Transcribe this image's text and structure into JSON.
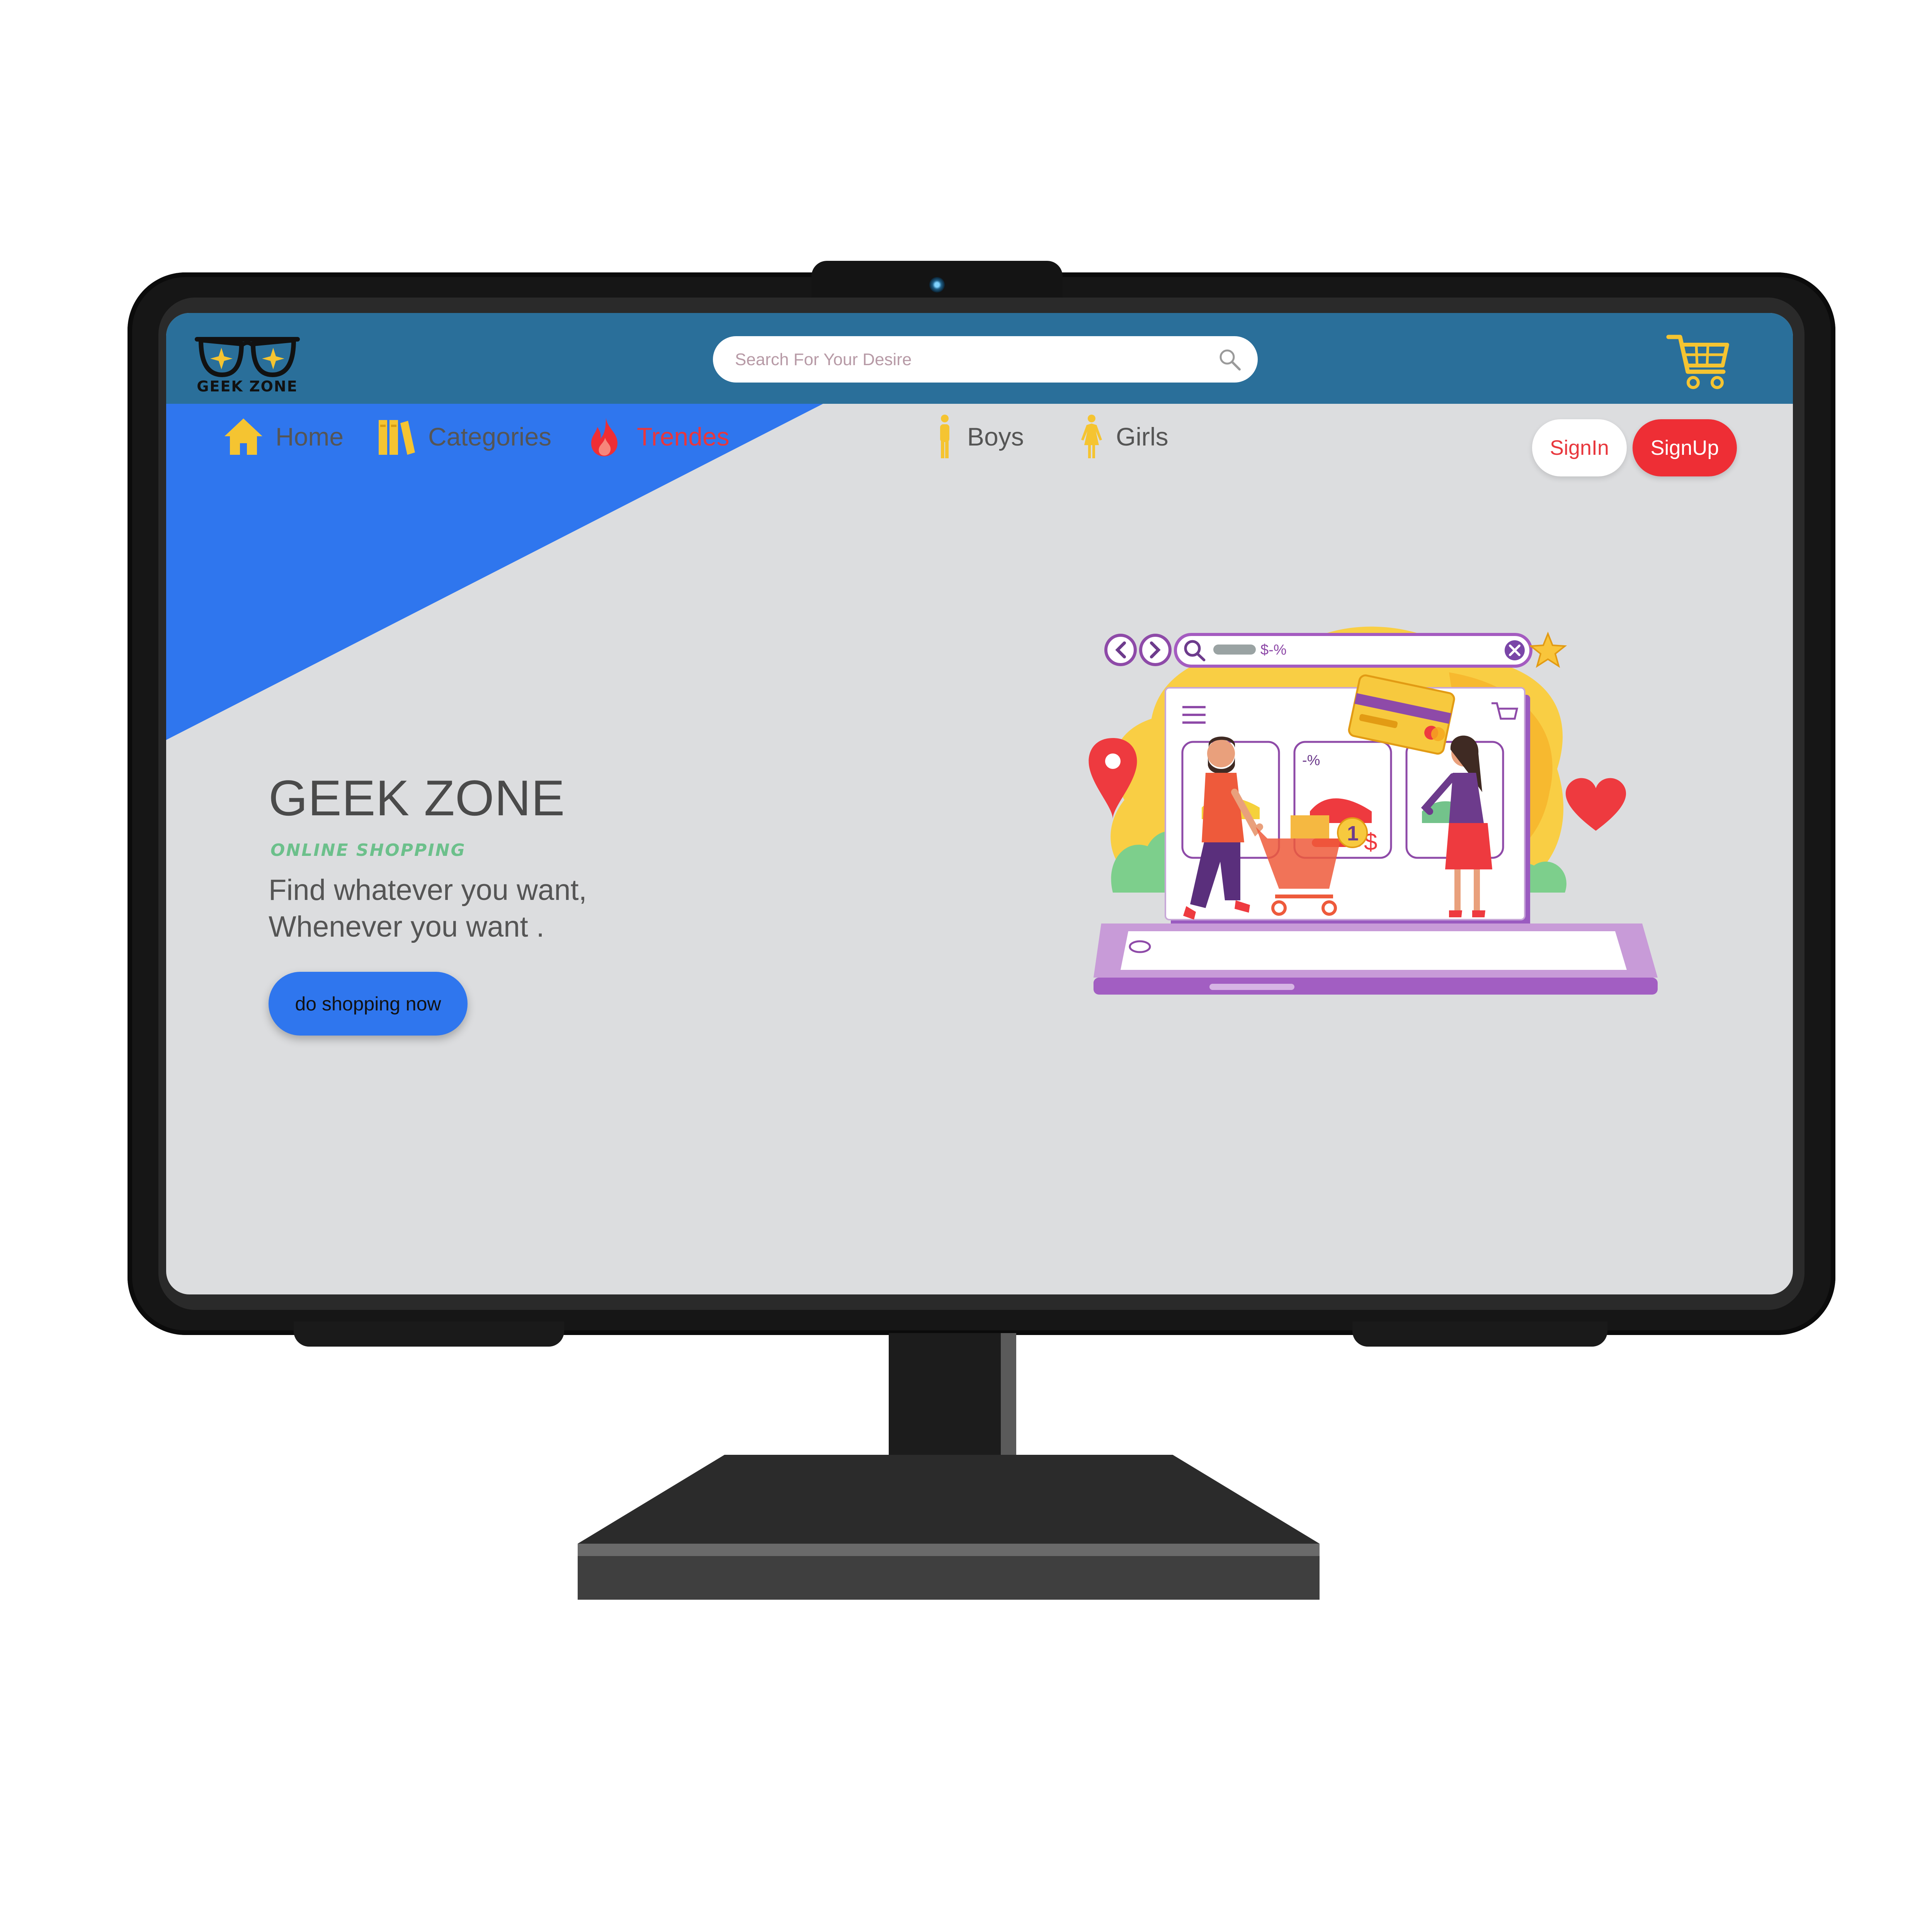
{
  "brand": {
    "logo_text": "GEEK ZONE"
  },
  "header": {
    "search_placeholder": "Search For Your Desire"
  },
  "nav": {
    "items": [
      {
        "label": "Home",
        "icon": "home-icon"
      },
      {
        "label": "Categories",
        "icon": "books-icon"
      },
      {
        "label": "Trendes",
        "icon": "fire-icon"
      },
      {
        "label": "Boys",
        "icon": "male-person-icon"
      },
      {
        "label": "Girls",
        "icon": "female-person-icon"
      }
    ]
  },
  "auth": {
    "signin_label": "SignIn",
    "signup_label": "SignUp"
  },
  "hero": {
    "title": "GEEK ZONE",
    "subtitle": "ONLINE SHOPPING",
    "line1": "Find whatever you want,",
    "line2": "Whenever you want .",
    "cta_label": "do shopping now"
  },
  "illustration": {
    "search_text": "$-%",
    "discount_text": "-%",
    "price_symbol": "$",
    "cart_badge": "1"
  },
  "colors": {
    "header": "#2a6f9a",
    "screen_bg": "#dcdddf",
    "hero_triangle": "#2f76ee",
    "accent_red": "#ee2e35",
    "icon_yellow": "#f5c431",
    "subtitle_green": "#6cc08b",
    "cta_blue": "#2f76ee"
  }
}
